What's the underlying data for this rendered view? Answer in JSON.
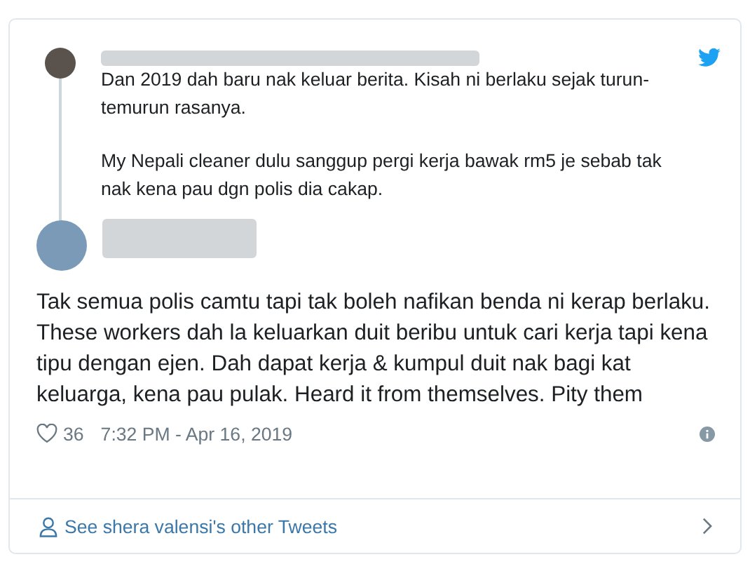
{
  "quoted_tweet": {
    "text_paragraphs": [
      "Dan 2019 dah baru nak keluar berita. Kisah ni berlaku sejak turun-temurun rasanya.",
      "My Nepali cleaner dulu sanggup pergi kerja bawak rm5 je sebab tak nak kena pau dgn polis dia cakap."
    ]
  },
  "tweet": {
    "text": "Tak semua polis camtu tapi tak boleh nafikan benda ni kerap berlaku. These workers dah la keluarkan duit beribu untuk cari kerja tapi kena tipu dengan ejen. Dah dapat kerja & kumpul duit nak bagi kat keluarga, kena pau pulak. Heard it from themselves. Pity them",
    "likes": "36",
    "timestamp": "7:32 PM - Apr 16, 2019"
  },
  "footer_link": "See shera valensi's other Tweets"
}
